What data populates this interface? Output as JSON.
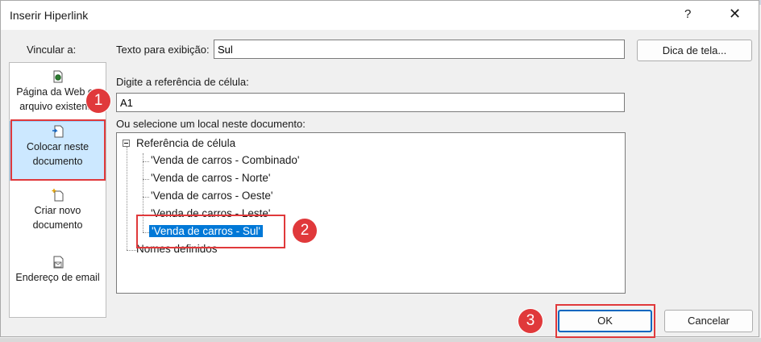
{
  "dialog": {
    "title": "Inserir Hiperlink",
    "help": "?",
    "close": "✕"
  },
  "link_to": {
    "label": "Vincular a:",
    "items": [
      {
        "label": "Página da Web ou arquivo existente",
        "icon": "web-page-icon"
      },
      {
        "label": "Colocar neste documento",
        "icon": "place-in-document-icon",
        "selected": true
      },
      {
        "label": "Criar novo documento",
        "icon": "new-document-icon"
      },
      {
        "label": "Endereço de email",
        "icon": "email-icon"
      }
    ]
  },
  "display_text": {
    "label": "Texto para exibição:",
    "value": "Sul"
  },
  "screentip_button": "Dica de tela...",
  "cell_ref": {
    "label": "Digite a referência de célula:",
    "value": "A1"
  },
  "place": {
    "label": "Ou selecione um local neste documento:",
    "root": "Referência de célula",
    "items": [
      "'Venda de carros - Combinado'",
      "'Venda de carros - Norte'",
      "'Venda de carros - Oeste'",
      "'Venda de carros - Leste'",
      "'Venda de carros - Sul'"
    ],
    "defined_names": "Nomes definidos"
  },
  "ok_button": "OK",
  "cancel_button": "Cancelar",
  "steps": [
    "1",
    "2",
    "3"
  ]
}
